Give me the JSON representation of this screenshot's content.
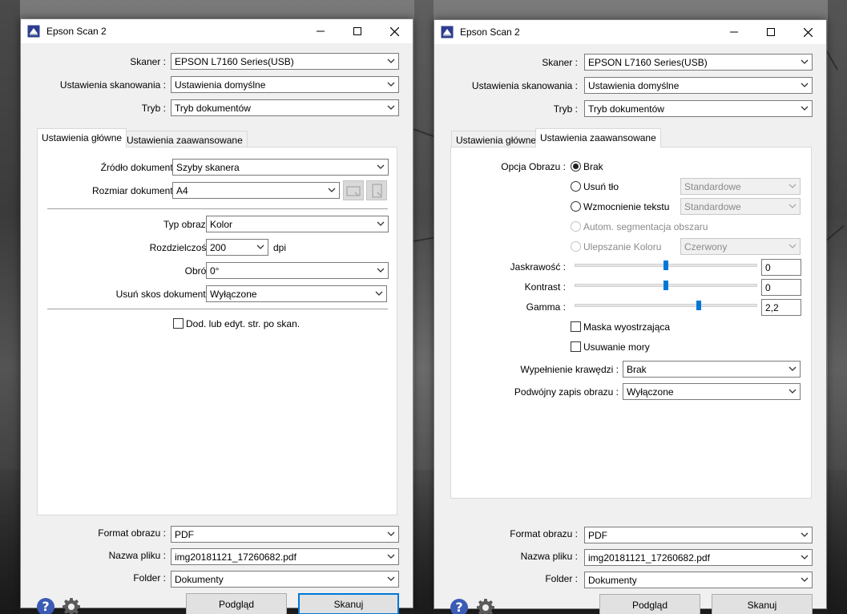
{
  "colors": {
    "accent": "#0078d7",
    "help": "#3b5bb5",
    "window_bg": "#f0f0f0"
  },
  "windows": [
    {
      "title": "Epson Scan 2",
      "app_icon": "epson-scan-icon",
      "top": {
        "skaner_label": "Skaner :",
        "skaner_value": "EPSON L7160 Series(USB)",
        "ustawienia_label": "Ustawienia skanowania :",
        "ustawienia_value": "Ustawienia domyślne",
        "tryb_label": "Tryb :",
        "tryb_value": "Tryb dokumentów"
      },
      "tabs": [
        {
          "label": "Ustawienia główne",
          "active": true
        },
        {
          "label": "Ustawienia zaawansowane",
          "active": false
        }
      ],
      "main": {
        "zrodlo_label": "Źródło dokumentu :",
        "zrodlo_value": "Szyby skanera",
        "rozmiar_label": "Rozmiar dokumentu :",
        "rozmiar_value": "A4",
        "typ_label": "Typ obrazu :",
        "typ_value": "Kolor",
        "rozdz_label": "Rozdzielczość :",
        "rozdz_value": "200",
        "rozdz_unit": "dpi",
        "obroc_label": "Obróć :",
        "obroc_value": "0°",
        "skos_label": "Usuń skos dokumentu :",
        "skos_value": "Wyłączone",
        "dod_label": "Dod. lub edyt. str. po skan.",
        "dod_checked": false
      },
      "bottom": {
        "format_label": "Format obrazu :",
        "format_value": "PDF",
        "nazwa_label": "Nazwa pliku :",
        "nazwa_value": "img20181121_17260682.pdf",
        "folder_label": "Folder :",
        "folder_value": "Dokumenty"
      },
      "buttons": {
        "preview": "Podgląd",
        "scan": "Skanuj"
      }
    },
    {
      "title": "Epson Scan 2",
      "app_icon": "epson-scan-icon",
      "top": {
        "skaner_label": "Skaner :",
        "skaner_value": "EPSON L7160 Series(USB)",
        "ustawienia_label": "Ustawienia skanowania :",
        "ustawienia_value": "Ustawienia domyślne",
        "tryb_label": "Tryb :",
        "tryb_value": "Tryb dokumentów"
      },
      "tabs": [
        {
          "label": "Ustawienia główne",
          "active": false
        },
        {
          "label": "Ustawienia zaawansowane",
          "active": true
        }
      ],
      "advanced": {
        "opcja_label": "Opcja Obrazu :",
        "brak": "Brak",
        "usun_tlo": "Usuń tło",
        "usun_tlo_value": "Standardowe",
        "wzmocnienie": "Wzmocnienie tekstu",
        "wzmocnienie_value": "Standardowe",
        "autom": "Autom. segmentacja obszaru",
        "ulepszanie": "Ulepszanie Koloru",
        "ulepszanie_value": "Czerwony",
        "jaskrawosc_label": "Jaskrawość :",
        "jaskrawosc_value": "0",
        "jaskrawosc_level": 0.5,
        "kontrast_label": "Kontrast :",
        "kontrast_value": "0",
        "kontrast_level": 0.5,
        "gamma_label": "Gamma :",
        "gamma_value": "2,2",
        "gamma_level": 0.68,
        "maska": "Maska wyostrzająca",
        "mory": "Usuwanie mory",
        "wypelnienie_label": "Wypełnienie krawędzi :",
        "wypelnienie_value": "Brak",
        "podwojny_label": "Podwójny zapis obrazu :",
        "podwojny_value": "Wyłączone"
      },
      "bottom": {
        "format_label": "Format obrazu :",
        "format_value": "PDF",
        "nazwa_label": "Nazwa pliku :",
        "nazwa_value": "img20181121_17260682.pdf",
        "folder_label": "Folder :",
        "folder_value": "Dokumenty"
      },
      "buttons": {
        "preview": "Podgląd",
        "scan": "Skanuj"
      }
    }
  ]
}
